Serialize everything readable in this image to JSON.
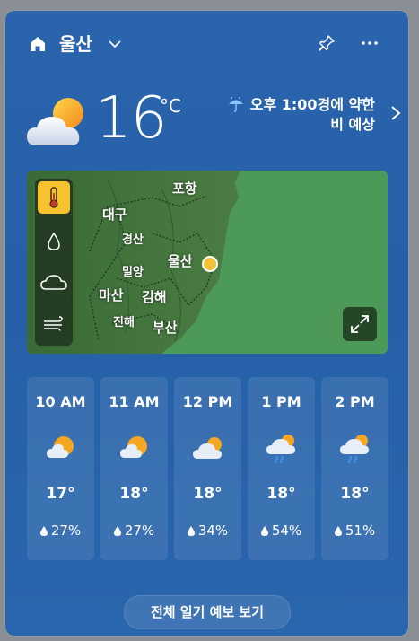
{
  "header": {
    "city": "울산",
    "icons": [
      "home-icon",
      "chevron-down-icon",
      "pin-icon",
      "more-icon"
    ]
  },
  "current": {
    "temperature": "16",
    "unit": "°C",
    "condition_icon": "partly-cloudy-icon",
    "forecast_line1": "오후 1:00경에 약한",
    "forecast_line2": "비 예상"
  },
  "map": {
    "labels": [
      "포항",
      "대구",
      "경산",
      "울산",
      "밀양",
      "마산",
      "김해",
      "진해",
      "부산"
    ],
    "layers": [
      {
        "icon": "thermometer-icon",
        "active": true
      },
      {
        "icon": "droplet-icon",
        "active": false
      },
      {
        "icon": "cloud-icon",
        "active": false
      },
      {
        "icon": "wind-icon",
        "active": false
      }
    ],
    "expand_icon": "expand-icon",
    "accent": "#f6c32f"
  },
  "hourly": [
    {
      "time": "10 AM",
      "temp": "17°",
      "precip": "27%",
      "icon": "partly-sunny-icon"
    },
    {
      "time": "11 AM",
      "temp": "18°",
      "precip": "27%",
      "icon": "partly-sunny-icon"
    },
    {
      "time": "12 PM",
      "temp": "18°",
      "precip": "34%",
      "icon": "mostly-cloudy-icon"
    },
    {
      "time": "1 PM",
      "temp": "18°",
      "precip": "54%",
      "icon": "cloud-rain-icon"
    },
    {
      "time": "2 PM",
      "temp": "18°",
      "precip": "51%",
      "icon": "cloud-rain-icon"
    }
  ],
  "footer": {
    "full_forecast": "전체 일기 예보 보기"
  }
}
